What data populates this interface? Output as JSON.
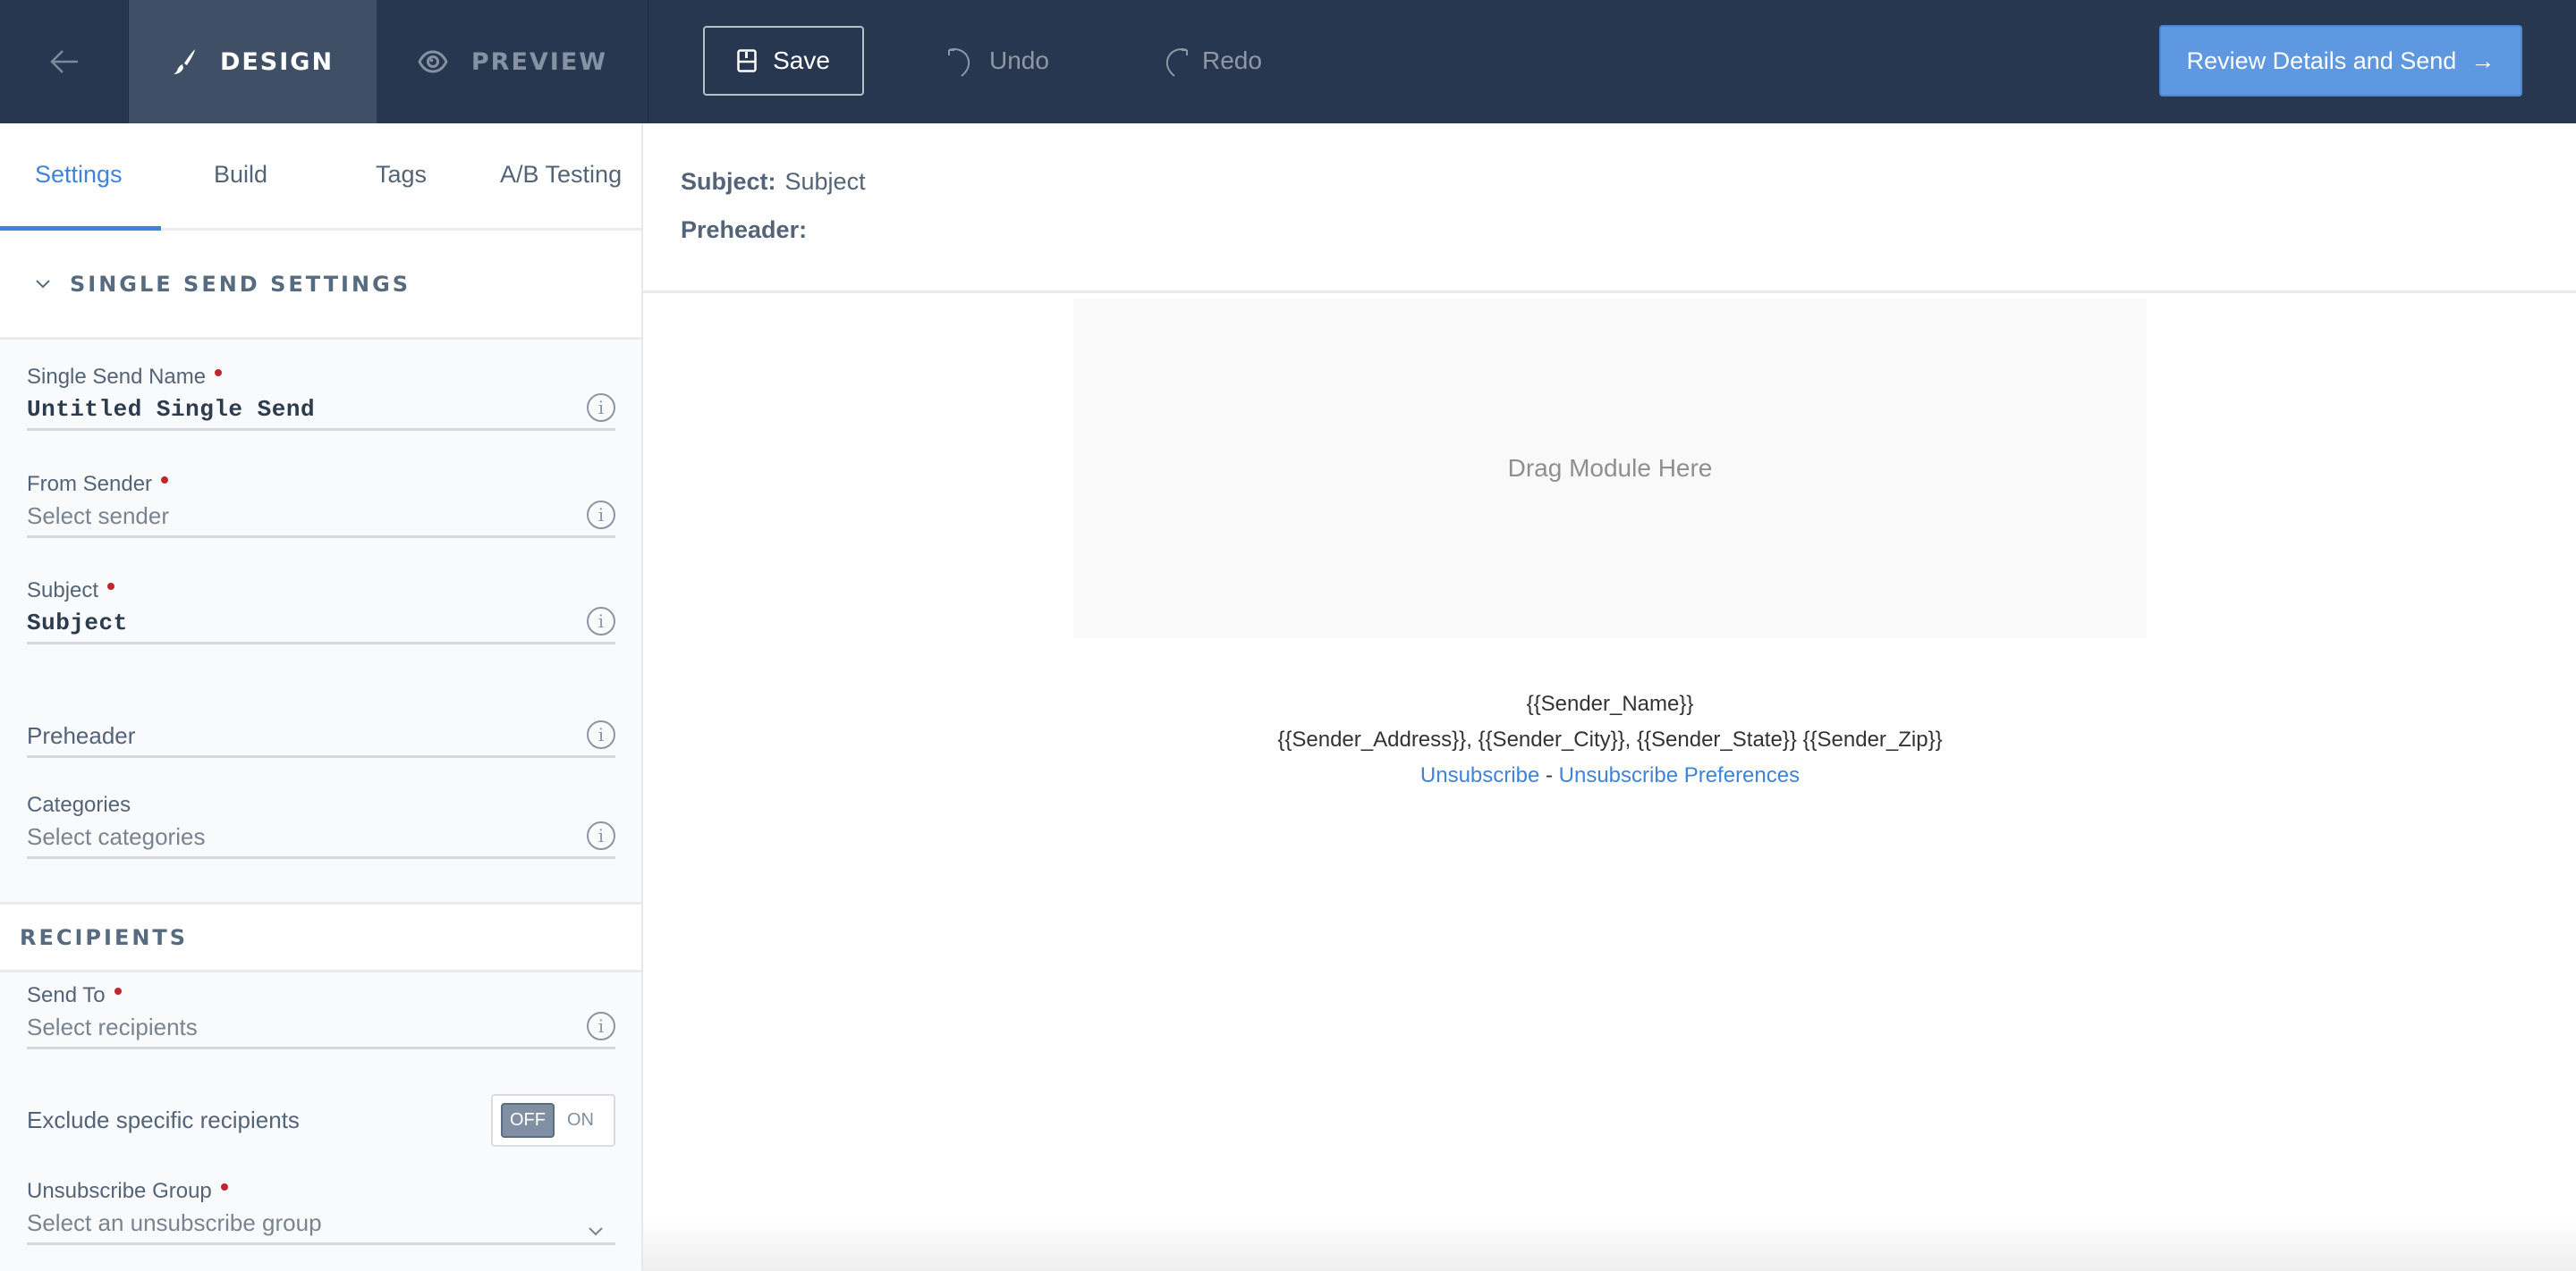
{
  "topbar": {
    "back_icon": "arrow-left-icon",
    "modes": [
      {
        "label": "DESIGN",
        "icon": "paintbrush-icon",
        "active": true
      },
      {
        "label": "PREVIEW",
        "icon": "eye-icon",
        "active": false
      }
    ],
    "save": {
      "label": "Save",
      "icon": "floppy-disk-icon"
    },
    "undo": {
      "label": "Undo",
      "icon": "undo-icon"
    },
    "redo": {
      "label": "Redo",
      "icon": "redo-icon"
    },
    "review": {
      "label": "Review Details and Send",
      "arrow": "→"
    }
  },
  "sidebar": {
    "tabs": [
      {
        "label": "Settings",
        "active": true
      },
      {
        "label": "Build",
        "active": false
      },
      {
        "label": "Tags",
        "active": false
      },
      {
        "label": "A/B Testing",
        "active": false
      }
    ],
    "settings_section": {
      "title": "SINGLE SEND SETTINGS",
      "fields": [
        {
          "label": "Single Send Name",
          "required": true,
          "value": "Untitled Single Send",
          "placeholder": ""
        },
        {
          "label": "From Sender",
          "required": true,
          "value": "",
          "placeholder": "Select sender"
        },
        {
          "label": "Subject",
          "required": true,
          "value": "Subject",
          "placeholder": ""
        },
        {
          "label": "",
          "required": false,
          "value": "",
          "placeholder": "Preheader"
        },
        {
          "label": "Categories",
          "required": false,
          "value": "",
          "placeholder": "Select categories"
        }
      ]
    },
    "recipients_section": {
      "title": "RECIPIENTS",
      "send_to": {
        "label": "Send To",
        "required": true,
        "placeholder": "Select recipients"
      },
      "exclude": {
        "label": "Exclude specific recipients",
        "off_label": "OFF",
        "on_label": "ON",
        "state": "OFF"
      },
      "unsubscribe_group": {
        "label": "Unsubscribe Group",
        "required": true,
        "placeholder": "Select an unsubscribe group"
      }
    }
  },
  "canvas": {
    "subject_key": "Subject:",
    "subject_value": "Subject",
    "preheader_key": "Preheader:",
    "preheader_value": "",
    "drop_zone": "Drag Module Here",
    "footer": {
      "sender_name": "{{Sender_Name}}",
      "sender_address": "{{Sender_Address}}, {{Sender_City}}, {{Sender_State}} {{Sender_Zip}}",
      "unsubscribe": "Unsubscribe",
      "separator": "-",
      "unsubscribe_prefs": "Unsubscribe Preferences"
    }
  },
  "colors": {
    "topbar_bg": "#27374f",
    "active_mode_bg": "#3f5066",
    "accent": "#3e84d9",
    "review_button": "#5e98e0",
    "required_dot": "#c0272d"
  }
}
